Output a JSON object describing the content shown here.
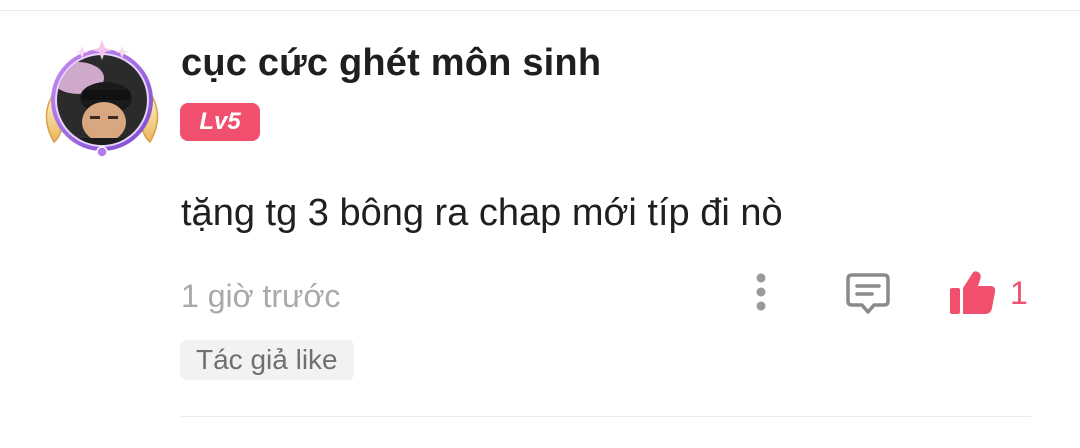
{
  "comment": {
    "username": "cục cức ghét môn sinh",
    "level_badge": "Lv5",
    "text": "tặng tg 3 bông ra chap mới típ đi nò",
    "timestamp": "1 giờ trước",
    "like_count": "1",
    "author_like_tag": "Tác giả like"
  },
  "icons": {
    "more": "more-vertical-icon",
    "reply": "comment-icon",
    "like": "thumbs-up-icon"
  },
  "colors": {
    "accent": "#f0506e",
    "username": "#1f1f1f",
    "muted": "#a9a9a9",
    "tag_bg": "#f2f2f2"
  }
}
